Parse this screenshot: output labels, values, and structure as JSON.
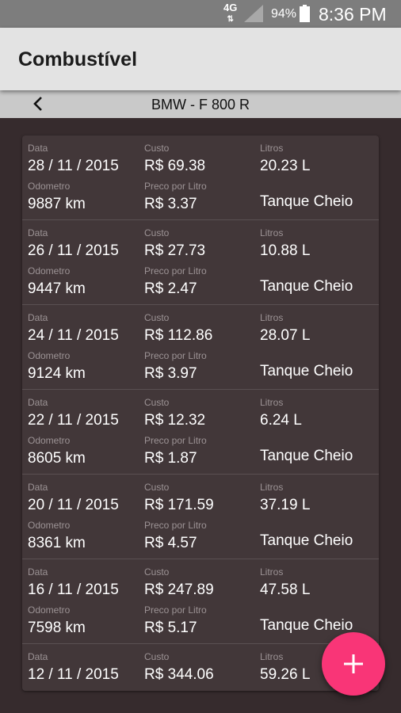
{
  "status_bar": {
    "network": "4G",
    "battery": "94%",
    "time": "8:36 PM"
  },
  "app_bar": {
    "title": "Combustível"
  },
  "subbar": {
    "vehicle": "BMW - F 800 R"
  },
  "labels": {
    "date": "Data",
    "cost": "Custo",
    "liters": "Litros",
    "odometer": "Odometro",
    "price_per_liter": "Preco por Litro"
  },
  "entries": [
    {
      "date": "28 / 11 / 2015",
      "cost": "R$ 69.38",
      "liters": "20.23 L",
      "odometer": "9887 km",
      "price": "R$ 3.37",
      "status": "Tanque Cheio"
    },
    {
      "date": "26 / 11 / 2015",
      "cost": "R$ 27.73",
      "liters": "10.88 L",
      "odometer": "9447 km",
      "price": "R$ 2.47",
      "status": "Tanque Cheio"
    },
    {
      "date": "24 / 11 / 2015",
      "cost": "R$ 112.86",
      "liters": "28.07 L",
      "odometer": "9124 km",
      "price": "R$ 3.97",
      "status": "Tanque Cheio"
    },
    {
      "date": "22 / 11 / 2015",
      "cost": "R$ 12.32",
      "liters": "6.24 L",
      "odometer": "8605 km",
      "price": "R$ 1.87",
      "status": "Tanque Cheio"
    },
    {
      "date": "20 / 11 / 2015",
      "cost": "R$ 171.59",
      "liters": "37.19 L",
      "odometer": "8361 km",
      "price": "R$ 4.57",
      "status": "Tanque Cheio"
    },
    {
      "date": "16 / 11 / 2015",
      "cost": "R$ 247.89",
      "liters": "47.58 L",
      "odometer": "7598 km",
      "price": "R$ 5.17",
      "status": "Tanque Cheio"
    },
    {
      "date": "12 / 11 / 2015",
      "cost": "R$ 344.06",
      "liters": "59.26 L",
      "odometer": "",
      "price": "",
      "status": ""
    }
  ],
  "fab": {
    "icon": "plus-icon",
    "color": "#f93577"
  },
  "colors": {
    "background": "#362b2d",
    "card": "#423739",
    "app_bar": "#e3e3e3",
    "subbar": "#c9c9c9",
    "status_bar": "#7d7d7d"
  }
}
